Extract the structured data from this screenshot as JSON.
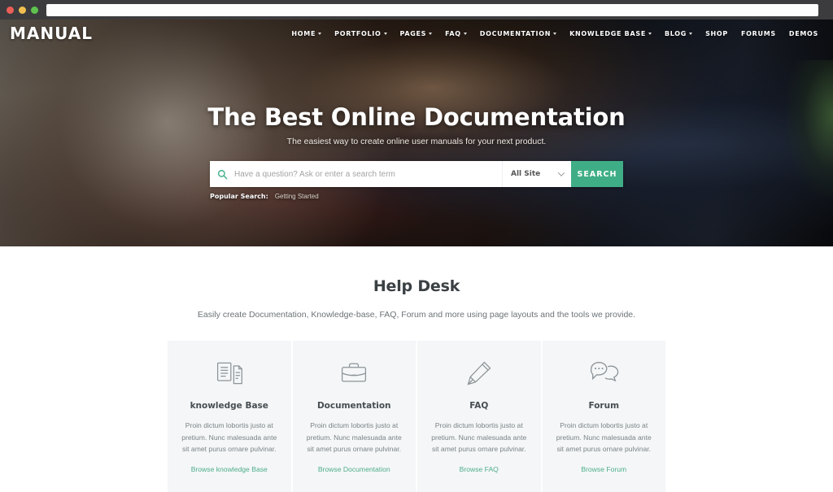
{
  "browser": {
    "url_value": "",
    "url_placeholder": "",
    "traffic_lights": [
      "close",
      "minimize",
      "maximize"
    ]
  },
  "header": {
    "logo": "MANUAL",
    "nav": [
      {
        "label": "HOME",
        "has_dropdown": true
      },
      {
        "label": "PORTFOLIO",
        "has_dropdown": true
      },
      {
        "label": "PAGES",
        "has_dropdown": true
      },
      {
        "label": "FAQ",
        "has_dropdown": true
      },
      {
        "label": "DOCUMENTATION",
        "has_dropdown": true
      },
      {
        "label": "KNOWLEDGE BASE",
        "has_dropdown": true
      },
      {
        "label": "BLOG",
        "has_dropdown": true
      },
      {
        "label": "SHOP",
        "has_dropdown": false
      },
      {
        "label": "FORUMS",
        "has_dropdown": false
      },
      {
        "label": "DEMOS",
        "has_dropdown": false
      }
    ]
  },
  "hero": {
    "title": "The Best Online Documentation",
    "subtitle": "The easiest way to create online user manuals for your next product.",
    "search": {
      "icon": "search-icon",
      "value": "",
      "placeholder": "Have a question? Ask or enter a search term",
      "scope_selected": "All Site",
      "button_label": "SEARCH"
    },
    "popular": {
      "label": "Popular Search:",
      "term": "Getting Started"
    }
  },
  "helpdesk": {
    "title": "Help Desk",
    "subtitle": "Easily create Documentation, Knowledge-base, FAQ, Forum and more using page layouts and the tools we provide.",
    "cards": [
      {
        "icon": "documents-icon",
        "title": "knowledge Base",
        "description": "Proin dictum lobortis justo at pretium. Nunc malesuada ante sit amet purus ornare pulvinar.",
        "link": "Browse knowledge Base"
      },
      {
        "icon": "briefcase-icon",
        "title": "Documentation",
        "description": "Proin dictum lobortis justo at pretium. Nunc malesuada ante sit amet purus ornare pulvinar.",
        "link": "Browse Documentation"
      },
      {
        "icon": "pencil-icon",
        "title": "FAQ",
        "description": "Proin dictum lobortis justo at pretium. Nunc malesuada ante sit amet purus ornare pulvinar.",
        "link": "Browse FAQ"
      },
      {
        "icon": "chat-bubbles-icon",
        "title": "Forum",
        "description": "Proin dictum lobortis justo at pretium. Nunc malesuada ante sit amet purus ornare pulvinar.",
        "link": "Browse Forum"
      }
    ]
  },
  "colors": {
    "accent_green": "#3fae86",
    "link_green": "#4fae8b",
    "card_bg": "#f4f6f7",
    "chrome_bg": "#3c3c3e"
  }
}
